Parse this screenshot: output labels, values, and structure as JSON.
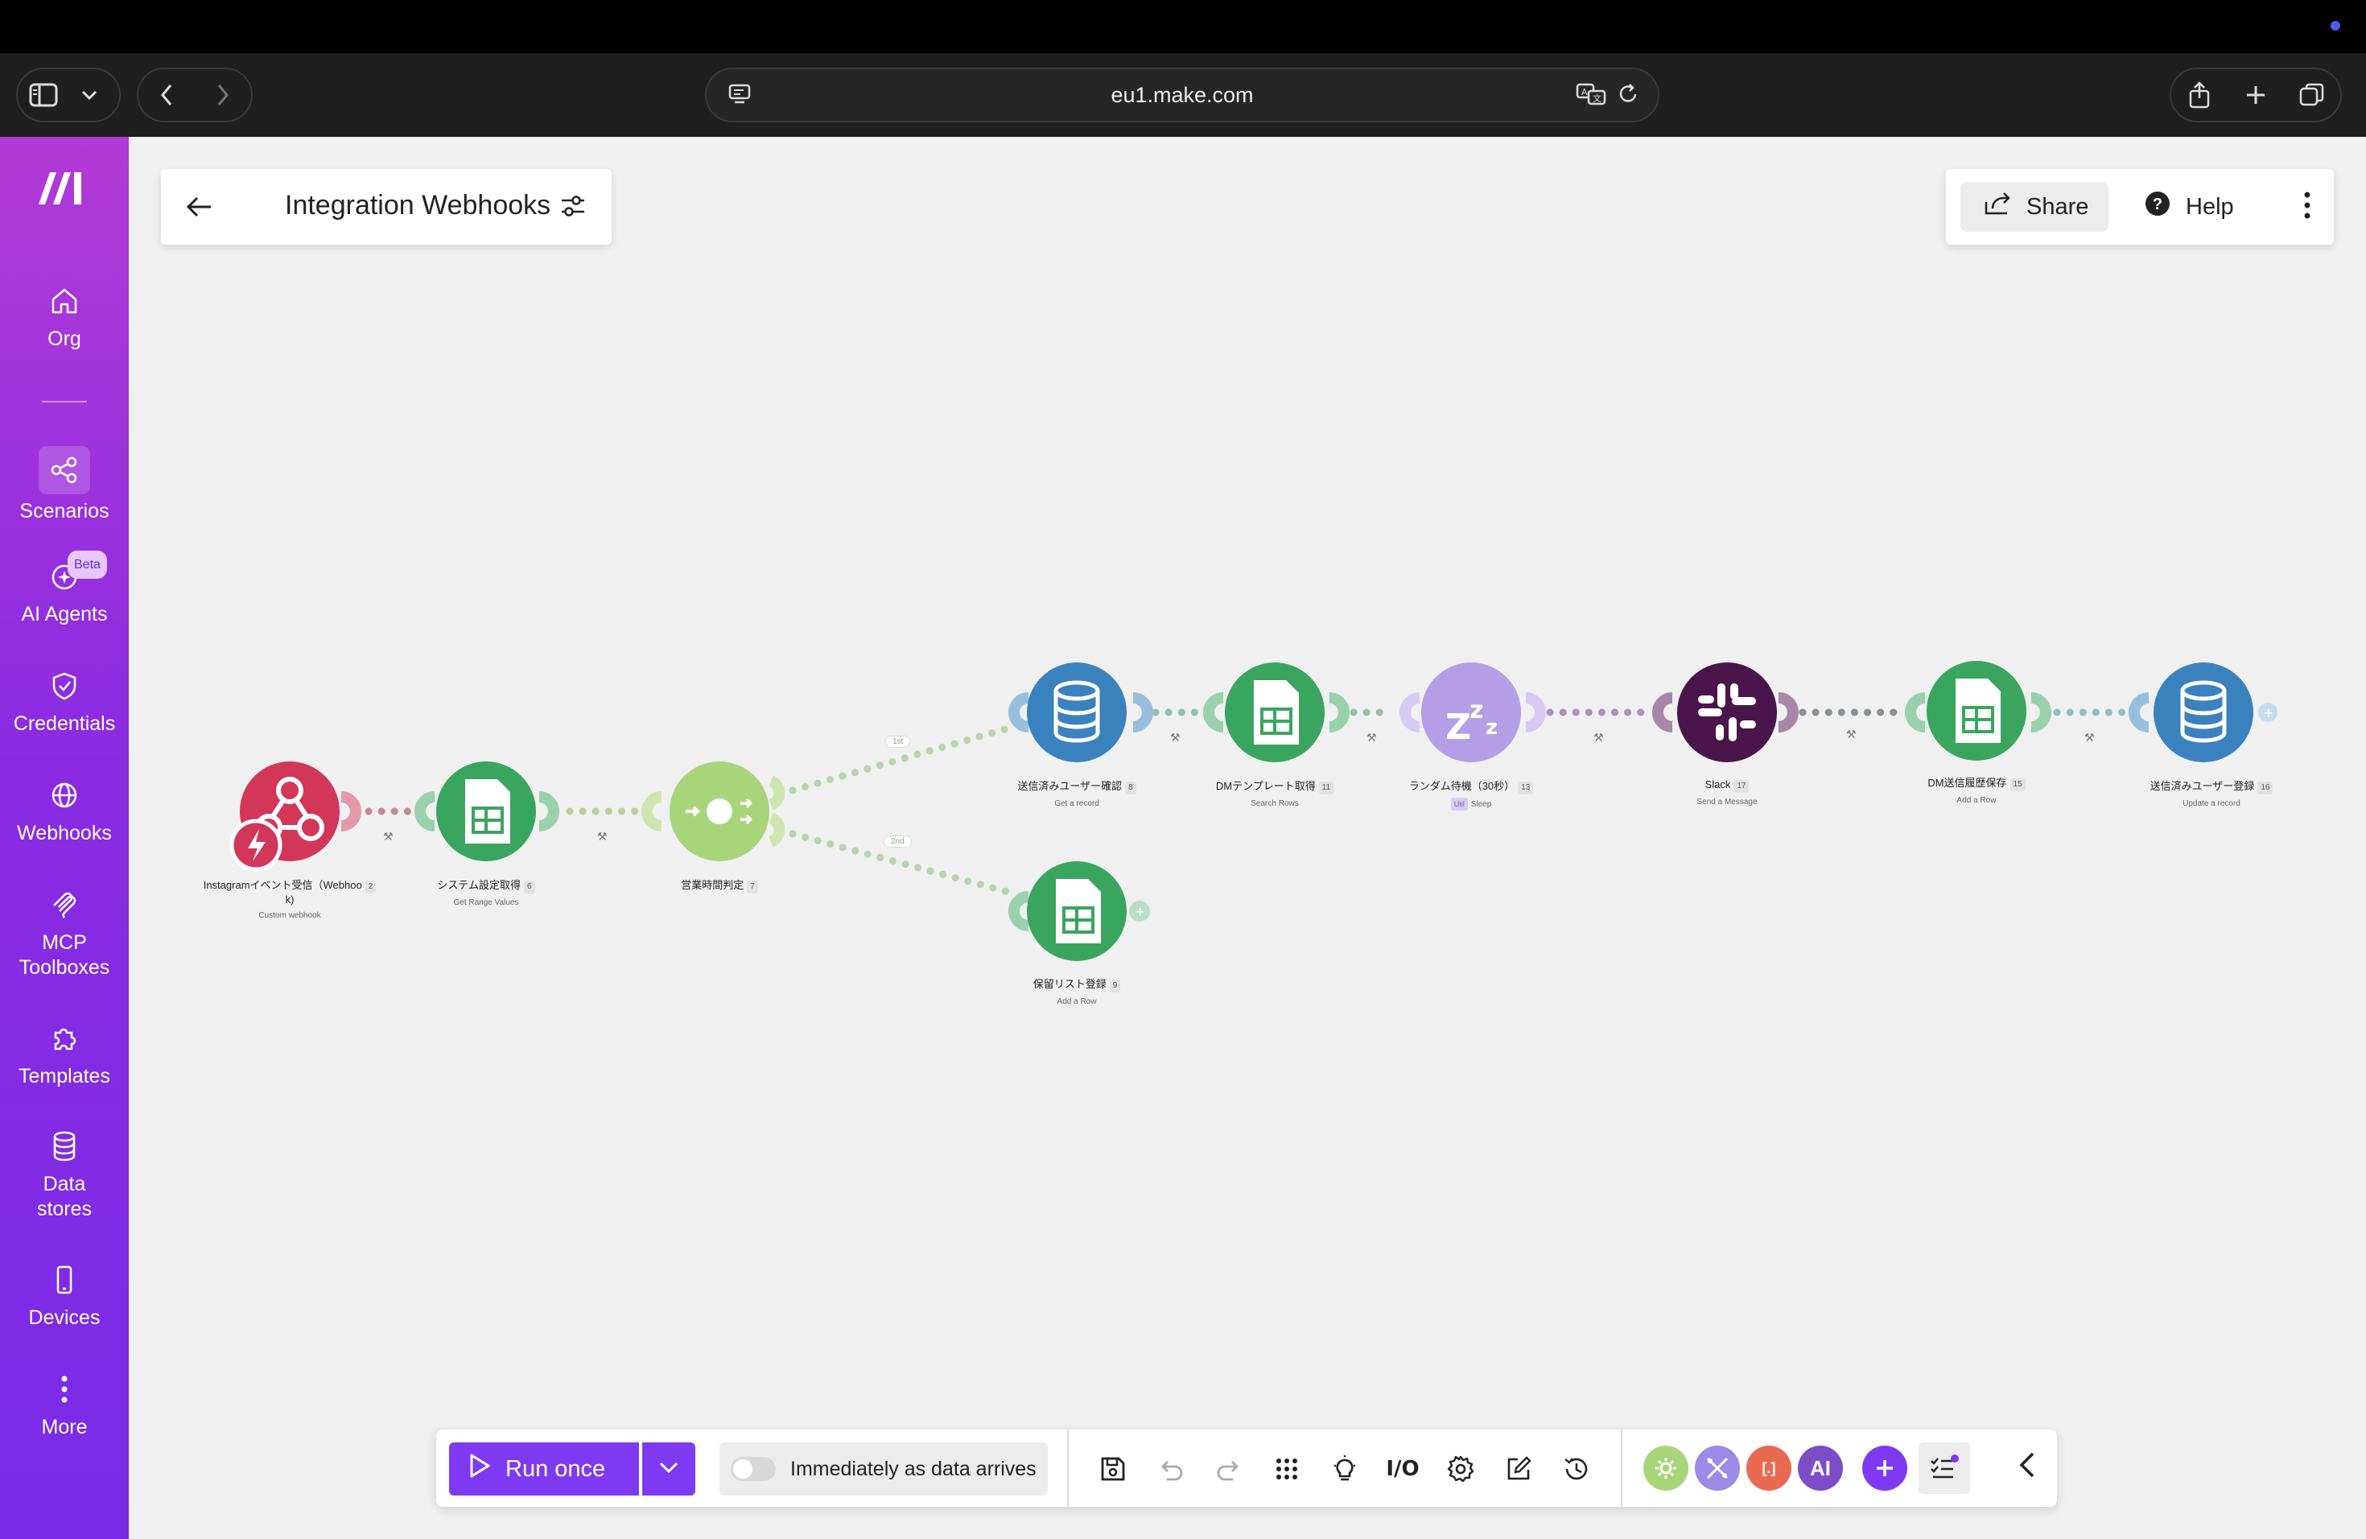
{
  "browser": {
    "url": "eu1.make.com"
  },
  "sidebar": {
    "items": [
      {
        "label": "Org",
        "icon": "home-icon"
      },
      {
        "label": "Scenarios",
        "icon": "share-nodes-icon",
        "active": true
      },
      {
        "label": "AI Agents",
        "icon": "ai-sparkle-icon",
        "badge": "Beta"
      },
      {
        "label": "Credentials",
        "icon": "shield-check-icon"
      },
      {
        "label": "Webhooks",
        "icon": "globe-icon"
      },
      {
        "label": "MCP\nToolboxes",
        "line1": "MCP",
        "line2": "Toolboxes",
        "icon": "mcp-icon"
      },
      {
        "label": "Templates",
        "icon": "puzzle-icon"
      },
      {
        "label": "Data\nstores",
        "line1": "Data",
        "line2": "stores",
        "icon": "database-icon"
      },
      {
        "label": "Devices",
        "icon": "phone-icon"
      },
      {
        "label": "More",
        "icon": "more-vertical-icon"
      }
    ]
  },
  "header": {
    "title": "Integration Webhooks",
    "share_label": "Share",
    "help_label": "Help"
  },
  "scenario": {
    "nodes": [
      {
        "id": "n1",
        "name": "Instagramイベント受信（Webhoo",
        "name2": "k)",
        "number": "2",
        "sub": "Custom webhook",
        "app": "webhooks",
        "color": "#d2375a"
      },
      {
        "id": "n2",
        "name": "システム設定取得",
        "number": "6",
        "sub": "Get Range Values",
        "app": "google-sheets",
        "color": "#3aa55e"
      },
      {
        "id": "n3",
        "name": "営業時間判定",
        "number": "7",
        "sub": "",
        "app": "router",
        "color": "#a8d57a"
      },
      {
        "id": "n4",
        "name": "送信済みユーザー確認",
        "number": "8",
        "sub": "Get a record",
        "app": "data-store",
        "color": "#3a82bd"
      },
      {
        "id": "n5",
        "name": "DMテンプレート取得",
        "number": "11",
        "sub": "Search Rows",
        "app": "google-sheets",
        "color": "#3aa55e"
      },
      {
        "id": "n6",
        "name": "ランダム待機（30秒）",
        "number": "13",
        "sub": "Sleep",
        "chip": "Util",
        "app": "sleep",
        "color": "#b49ee8"
      },
      {
        "id": "n7",
        "name": "Slack",
        "number": "17",
        "sub": "Send a Message",
        "app": "slack",
        "color": "#4a154b"
      },
      {
        "id": "n8",
        "name": "DM送信履歴保存",
        "number": "15",
        "sub": "Add a Row",
        "app": "google-sheets",
        "color": "#3aa55e"
      },
      {
        "id": "n9",
        "name": "送信済みユーザー登録",
        "number": "16",
        "sub": "Update a record",
        "app": "data-store",
        "color": "#3a82bd"
      },
      {
        "id": "n10",
        "name": "保留リスト登録",
        "number": "9",
        "sub": "Add a Row",
        "app": "google-sheets",
        "color": "#3aa55e"
      }
    ],
    "routes": [
      "1st",
      "2nd"
    ]
  },
  "toolbar": {
    "run_label": "Run once",
    "schedule_label": "Immediately as data arrives",
    "schedule_on": false,
    "ai_label": "AI",
    "bracket_label": "[.]",
    "io_label": "I/O"
  },
  "colors": {
    "brand_purple": "#7e3af2",
    "sidebar_top": "#b23ad6",
    "sidebar_bottom": "#7a2be8"
  }
}
